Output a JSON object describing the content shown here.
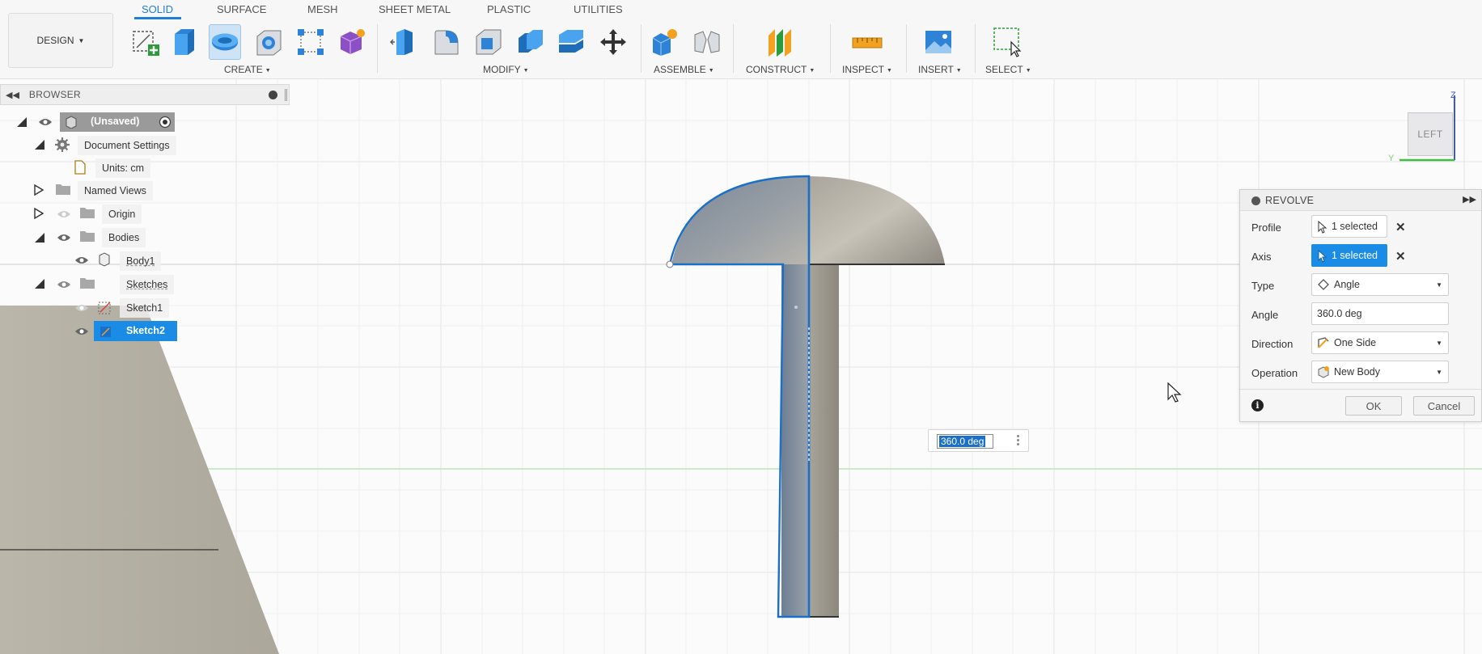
{
  "workspace": {
    "label": "DESIGN"
  },
  "tabs": [
    "SOLID",
    "SURFACE",
    "MESH",
    "SHEET METAL",
    "PLASTIC",
    "UTILITIES"
  ],
  "tool_groups": {
    "create": "CREATE",
    "modify": "MODIFY",
    "assemble": "ASSEMBLE",
    "construct": "CONSTRUCT",
    "inspect": "INSPECT",
    "insert": "INSERT",
    "select": "SELECT"
  },
  "browser": {
    "title": "BROWSER",
    "root": "(Unsaved)",
    "document_settings": "Document Settings",
    "units": "Units: cm",
    "named_views": "Named Views",
    "origin": "Origin",
    "bodies": "Bodies",
    "body1": "Body1",
    "sketches": "Sketches",
    "sketch1": "Sketch1",
    "sketch2": "Sketch2"
  },
  "revolve": {
    "title": "REVOLVE",
    "profile_label": "Profile",
    "profile_value": "1 selected",
    "axis_label": "Axis",
    "axis_value": "1 selected",
    "type_label": "Type",
    "type_value": "Angle",
    "angle_label": "Angle",
    "angle_value": "360.0 deg",
    "direction_label": "Direction",
    "direction_value": "One Side",
    "operation_label": "Operation",
    "operation_value": "New Body",
    "ok": "OK",
    "cancel": "Cancel"
  },
  "hud_input": "360.0 deg",
  "viewcube": {
    "face": "LEFT",
    "axis_z": "Z",
    "axis_y": "Y"
  },
  "colors": {
    "accent": "#1a8ce6",
    "tab_active": "#1f7fd4",
    "selection_blue": "#1a70c8",
    "body_metal": "#9a968c",
    "grid": "#e3e3e3",
    "axis_green": "#b8e6b8"
  }
}
